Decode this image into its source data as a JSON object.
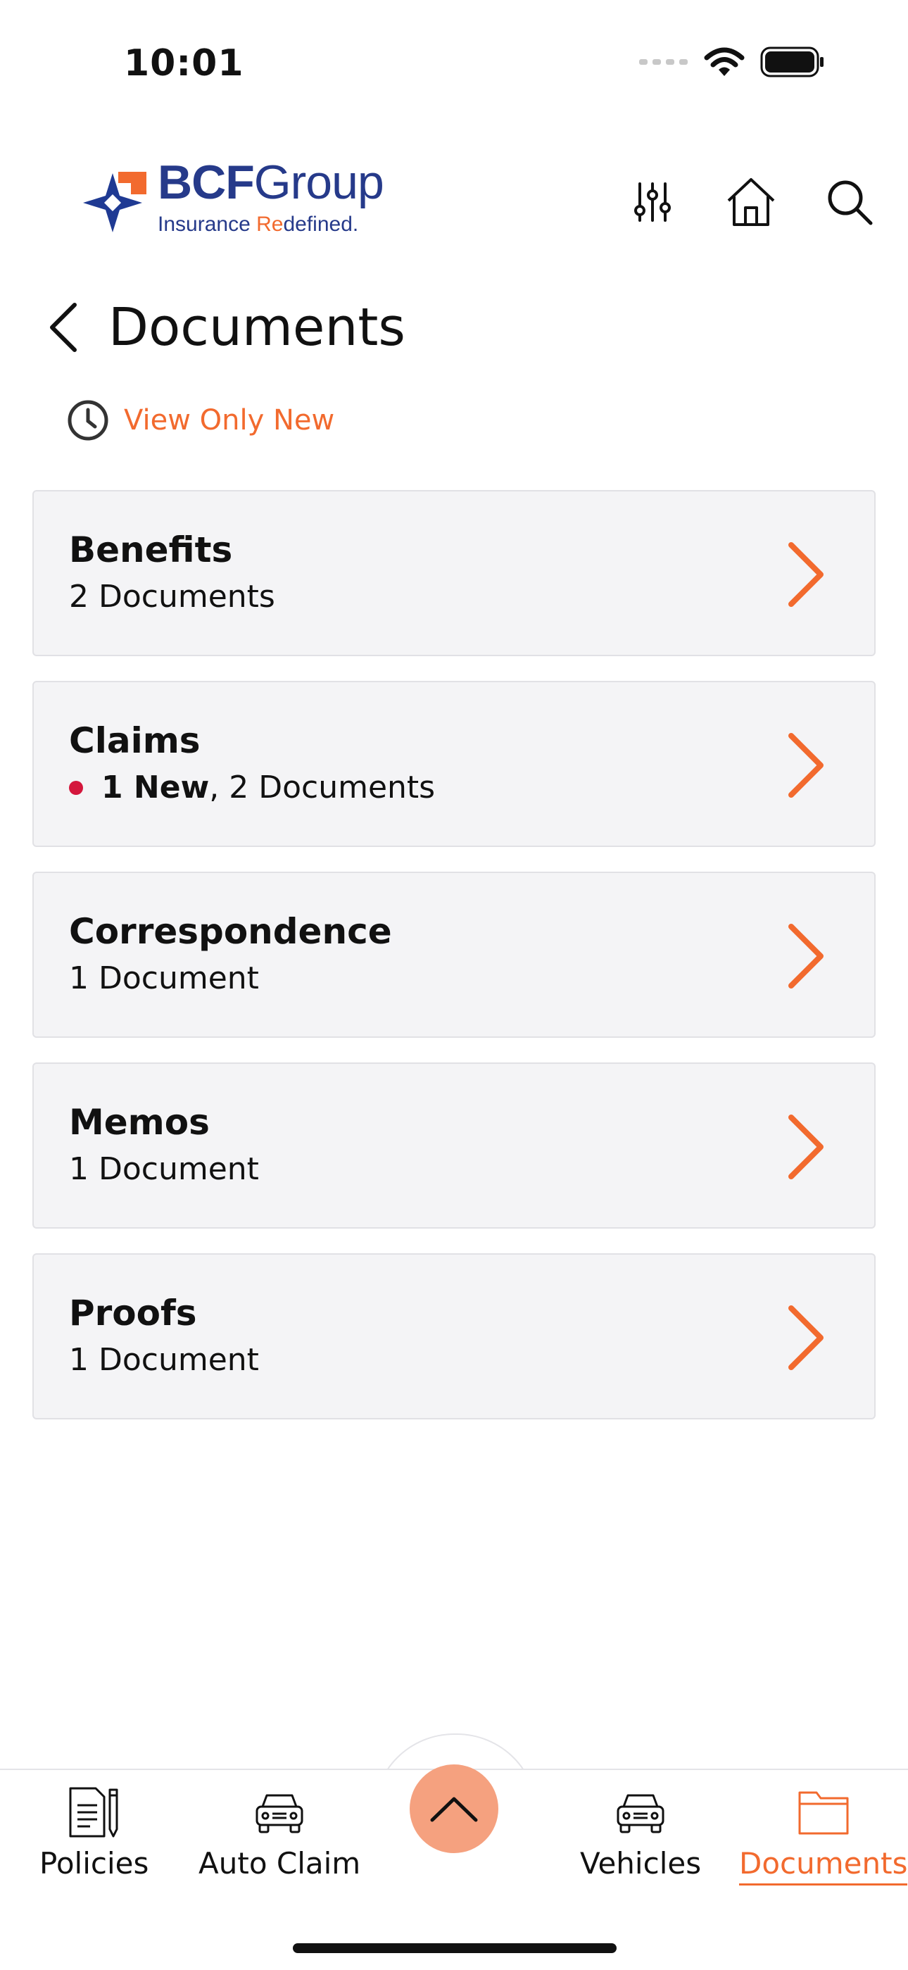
{
  "status_bar": {
    "time": "10:01"
  },
  "brand": {
    "name_bold": "BCF",
    "name_regular": "Group",
    "tagline_part1": "Insurance ",
    "tagline_highlight": "Re",
    "tagline_part2": "defined."
  },
  "header": {
    "filter_icon": "sliders-icon",
    "home_icon": "home-icon",
    "search_icon": "search-icon"
  },
  "page": {
    "title": "Documents"
  },
  "filter": {
    "view_new_label": "View Only New"
  },
  "folders": [
    {
      "name": "Benefits",
      "new_count_label": "",
      "count_label": "2 Documents"
    },
    {
      "name": "Claims",
      "new_count_label": "1 New",
      "count_label": ", 2 Documents"
    },
    {
      "name": "Correspondence",
      "new_count_label": "",
      "count_label": "1 Document"
    },
    {
      "name": "Memos",
      "new_count_label": "",
      "count_label": "1 Document"
    },
    {
      "name": "Proofs",
      "new_count_label": "",
      "count_label": "1 Document"
    }
  ],
  "nav": {
    "policies": "Policies",
    "auto_claim": "Auto Claim",
    "vehicles": "Vehicles",
    "documents": "Documents",
    "active": "documents"
  },
  "colors": {
    "accent": "#f26a2e",
    "brand_blue": "#263a8a",
    "new_dot": "#d4163c",
    "fab": "#f5a17f"
  }
}
